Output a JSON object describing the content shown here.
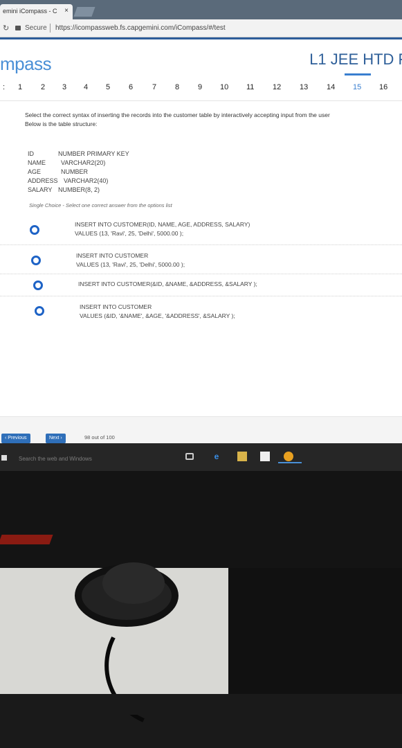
{
  "browser": {
    "tab_title": "emini iCompass - C",
    "tab_close": "×",
    "secure_label": "Secure",
    "url": "https://icompassweb.fs.capgemini.com/iCompass/#/test"
  },
  "header": {
    "logo": "mpass",
    "exam_title": "L1 JEE HTD F"
  },
  "qnav": {
    "colon": ":",
    "numbers": [
      "1",
      "2",
      "3",
      "4",
      "5",
      "6",
      "7",
      "8",
      "9",
      "10",
      "11",
      "12",
      "13",
      "14",
      "15",
      "16"
    ],
    "active": "15"
  },
  "question": {
    "line1": "Select the correct syntax of inserting the records into the customer table by interactively accepting input from the user",
    "line2": "Below is the table structure:",
    "structure": [
      {
        "col": "ID",
        "type": "NUMBER PRIMARY KEY"
      },
      {
        "col": "NAME",
        "type": "VARCHAR2(20)"
      },
      {
        "col": "AGE",
        "type": "NUMBER"
      },
      {
        "col": "ADDRESS",
        "type": "VARCHAR2(40)"
      },
      {
        "col": "SALARY",
        "type": "NUMBER(8, 2)"
      }
    ],
    "hint": "Single Choice - Select one correct answer from the options list"
  },
  "options": [
    {
      "line1": "INSERT INTO CUSTOMER(ID, NAME, AGE, ADDRESS, SALARY)",
      "line2": "VALUES (13, 'Ravi', 25, 'Delhi', 5000.00 );"
    },
    {
      "line1": "INSERT INTO CUSTOMER",
      "line2": "VALUES (13, 'Ravi', 25, 'Delhi', 5000.00 );"
    },
    {
      "line1": "INSERT INTO CUSTOMER(&ID, &NAME, &ADDRESS, &SALARY );",
      "line2": ""
    },
    {
      "line1": "INSERT INTO CUSTOMER",
      "line2": "VALUES (&ID, '&NAME', &AGE, '&ADDRESS', &SALARY );"
    }
  ],
  "footer": {
    "previous": "‹ Previous",
    "next": "Next ›",
    "progress": "98 out of 100"
  },
  "taskbar": {
    "search": "Search the web and Windows"
  }
}
